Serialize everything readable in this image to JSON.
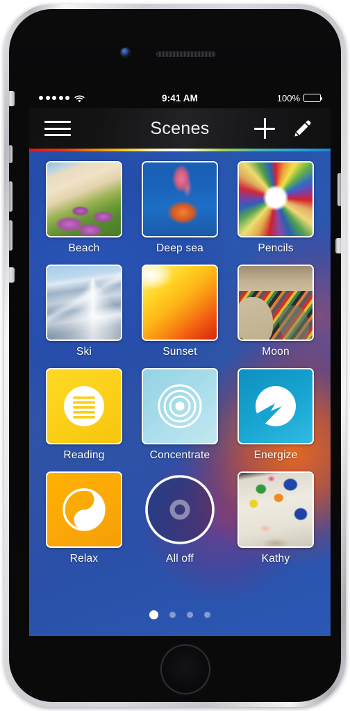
{
  "status_bar": {
    "signal_dots": 5,
    "wifi_icon": "wifi-icon",
    "time": "9:41 AM",
    "battery_percent": "100%",
    "battery_level": 100
  },
  "nav_bar": {
    "menu_icon": "hamburger-menu-icon",
    "title": "Scenes",
    "add_icon": "plus-icon",
    "edit_icon": "pencil-icon"
  },
  "accent_colors": {
    "reading": "#fbcf18",
    "concentrate": "#a6dcea",
    "energize": "#17a3d0",
    "relax": "#fba808",
    "wallpaper_blue": "#2a57b0",
    "wallpaper_orange": "#ec681c"
  },
  "scenes": [
    {
      "label": "Beach",
      "kind": "photo",
      "art": "ph-beach",
      "icon": "beach-photo-thumbnail"
    },
    {
      "label": "Deep sea",
      "kind": "photo",
      "art": "ph-sea",
      "icon": "jellyfish-photo-thumbnail"
    },
    {
      "label": "Pencils",
      "kind": "photo",
      "art": "ph-pencils",
      "icon": "colored-pencils-photo-thumbnail"
    },
    {
      "label": "Ski",
      "kind": "photo",
      "art": "ph-ski",
      "icon": "snowy-mountain-photo-thumbnail"
    },
    {
      "label": "Sunset",
      "kind": "photo",
      "art": "ph-sunset",
      "icon": "sunset-sky-photo-thumbnail"
    },
    {
      "label": "Moon",
      "kind": "photo",
      "art": "ph-moon",
      "icon": "striped-socks-photo-thumbnail"
    },
    {
      "label": "Reading",
      "kind": "glyph",
      "art": "t-reading",
      "icon": "reading-lines-icon"
    },
    {
      "label": "Concentrate",
      "kind": "glyph",
      "art": "t-concentrate",
      "icon": "concentric-rings-icon"
    },
    {
      "label": "Energize",
      "kind": "glyph",
      "art": "t-energize",
      "icon": "lightning-bolt-circle-icon"
    },
    {
      "label": "Relax",
      "kind": "glyph",
      "art": "t-relax",
      "icon": "yin-yang-drop-icon"
    },
    {
      "label": "All off",
      "kind": "glyph",
      "art": "t-alloff",
      "icon": "power-off-circle-icon"
    },
    {
      "label": "Kathy",
      "kind": "photo",
      "art": "ph-kathy",
      "icon": "handprint-painting-photo-thumbnail"
    }
  ],
  "pagination": {
    "total_pages": 4,
    "current_page": 1
  },
  "hardware": {
    "camera": "front-camera",
    "speaker": "earpiece-speaker",
    "home_button": "home-button"
  }
}
